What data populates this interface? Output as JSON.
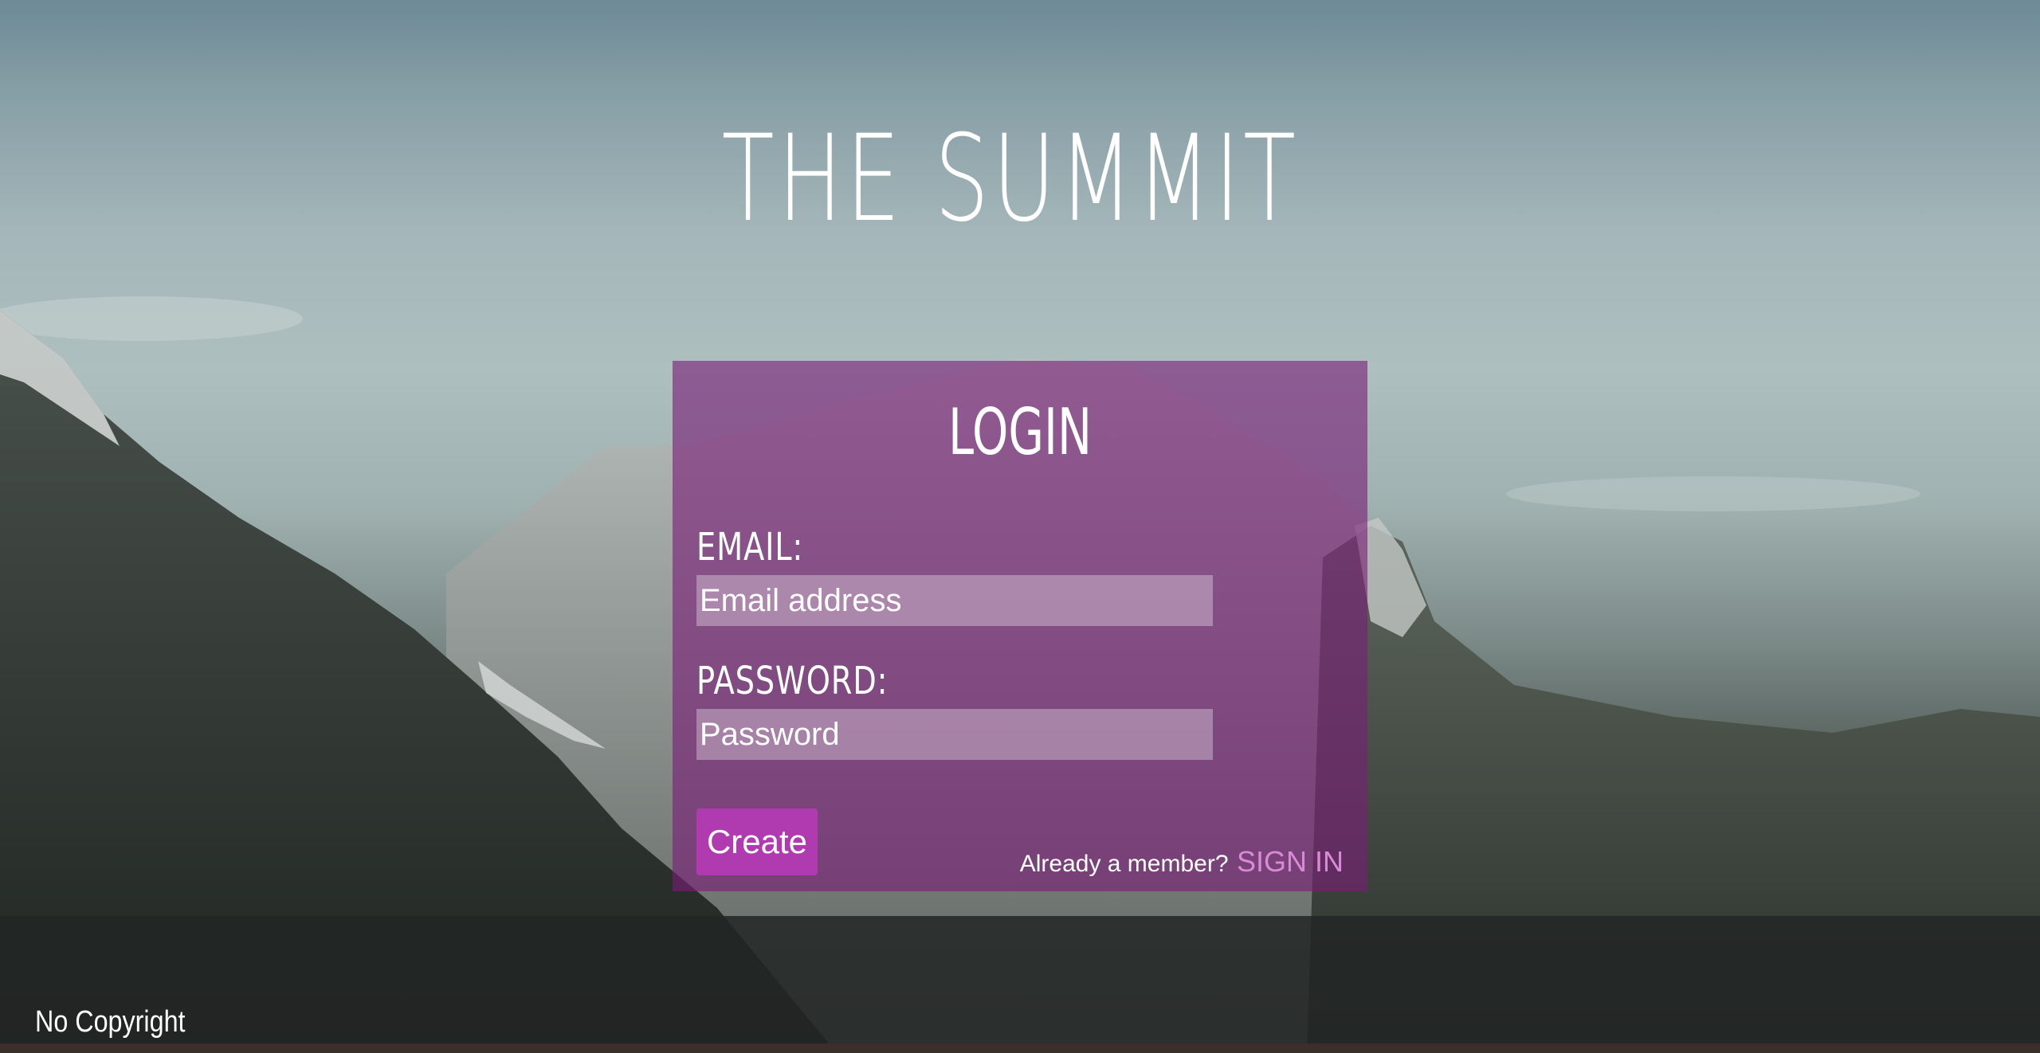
{
  "site": {
    "title": "THE SUMMIT"
  },
  "login": {
    "heading": "LOGIN",
    "email_label": "EMAIL:",
    "email_placeholder": "Email address",
    "password_label": "PASSWORD:",
    "password_placeholder": "Password",
    "create_label": "Create",
    "member_prompt": "Already a member?",
    "signin_label": "SIGN IN"
  },
  "footer": {
    "copyright": "No Copyright"
  },
  "colors": {
    "panel_overlay": "#791e78",
    "button": "#b03bb1",
    "signin_link": "#d98ad6",
    "text": "#ffffff"
  }
}
